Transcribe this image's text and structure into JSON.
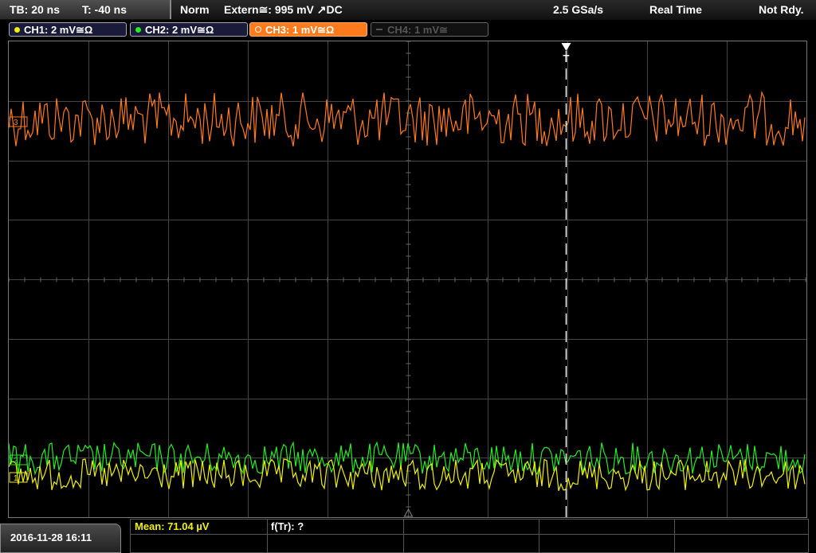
{
  "header": {
    "timebase": "TB: 20 ns",
    "trigger_time": "T: -40 ns",
    "mode": "Norm",
    "trigger_source": "Extern≅: 995 mV ↗DC",
    "sample_rate": "2.5 GSa/s",
    "acq_mode": "Real Time",
    "status": "Not Rdy."
  },
  "channels": [
    {
      "label": "CH1: 2 mV≅Ω",
      "color": "#f0f000",
      "active": true
    },
    {
      "label": "CH2: 2 mV≅Ω",
      "color": "#22ee22",
      "active": true
    },
    {
      "label": "CH3: 1 mV≅Ω",
      "color": "#ff7a1a",
      "active": true,
      "selected": true
    },
    {
      "label": "CH4: 1 mV≅",
      "color": "#555555",
      "active": false
    }
  ],
  "trigger_marker": "T",
  "channel_markers": {
    "ch1": "1",
    "ch2": "2",
    "ch3": "3"
  },
  "footer": {
    "datetime": "2016-11-28 16:11",
    "mean": "Mean: 71.04 µV",
    "freq": "f(Tr): ?"
  },
  "colors": {
    "ch1": "#f0f000",
    "ch2": "#22ee22",
    "ch3": "#ff7a1a",
    "grid": "#444444",
    "mean_text": "#f0f000"
  }
}
